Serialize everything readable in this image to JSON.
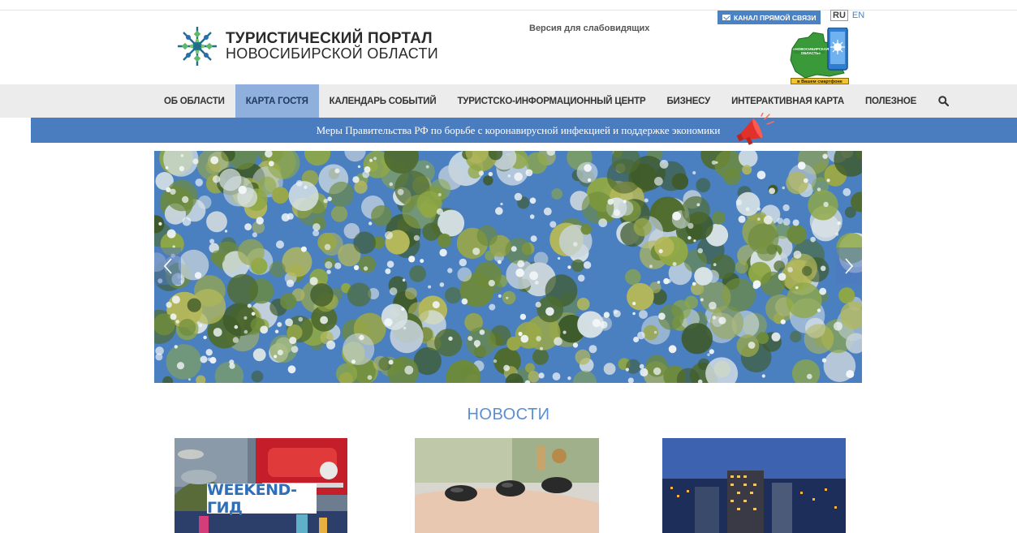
{
  "header": {
    "logo_line1": "ТУРИСТИЧЕСКИЙ ПОРТАЛ",
    "logo_line2": "НОВОСИБИРСКОЙ ОБЛАСТИ",
    "accessibility_link": "Версия для слабовидящих",
    "direct_channel_label": "КАНАЛ ПРЯМОЙ СВЯЗИ",
    "languages": [
      "RU",
      "EN"
    ],
    "active_language": "RU",
    "app_promo_title": "«НОВОСИБИРСКАЯ ОБЛАСТЬ»",
    "app_promo_caption": "в Вашем смартфоне"
  },
  "nav": {
    "items": [
      {
        "label": "ОБ ОБЛАСТИ",
        "active": false
      },
      {
        "label": "КАРТА ГОСТЯ",
        "active": true
      },
      {
        "label": "КАЛЕНДАРЬ СОБЫТИЙ",
        "active": false
      },
      {
        "label": "ТУРИСТСКО-ИНФОРМАЦИОННЫЙ ЦЕНТР",
        "active": false
      },
      {
        "label": "БИЗНЕСУ",
        "active": false
      },
      {
        "label": "ИНТЕРАКТИВНАЯ КАРТА",
        "active": false
      },
      {
        "label": "ПОЛЕЗНОЕ",
        "active": false
      }
    ],
    "search_icon": "search-icon"
  },
  "banner": {
    "text": "Меры Правительства РФ по борьбе с коронавирусной инфекцией и поддержке экономики",
    "icon": "megaphone-icon"
  },
  "slider": {
    "prev_icon": "chevron-left-icon",
    "next_icon": "chevron-right-icon"
  },
  "news": {
    "title": "НОВОСТИ",
    "cards": [
      {
        "label": "WEEKEND-ГИД"
      },
      {
        "label": ""
      },
      {
        "label": ""
      }
    ]
  },
  "colors": {
    "accent": "#4a7dc0",
    "nav_active": "#8fb0dc",
    "news_title": "#5b8fcf",
    "nav_bg": "#ececec"
  }
}
